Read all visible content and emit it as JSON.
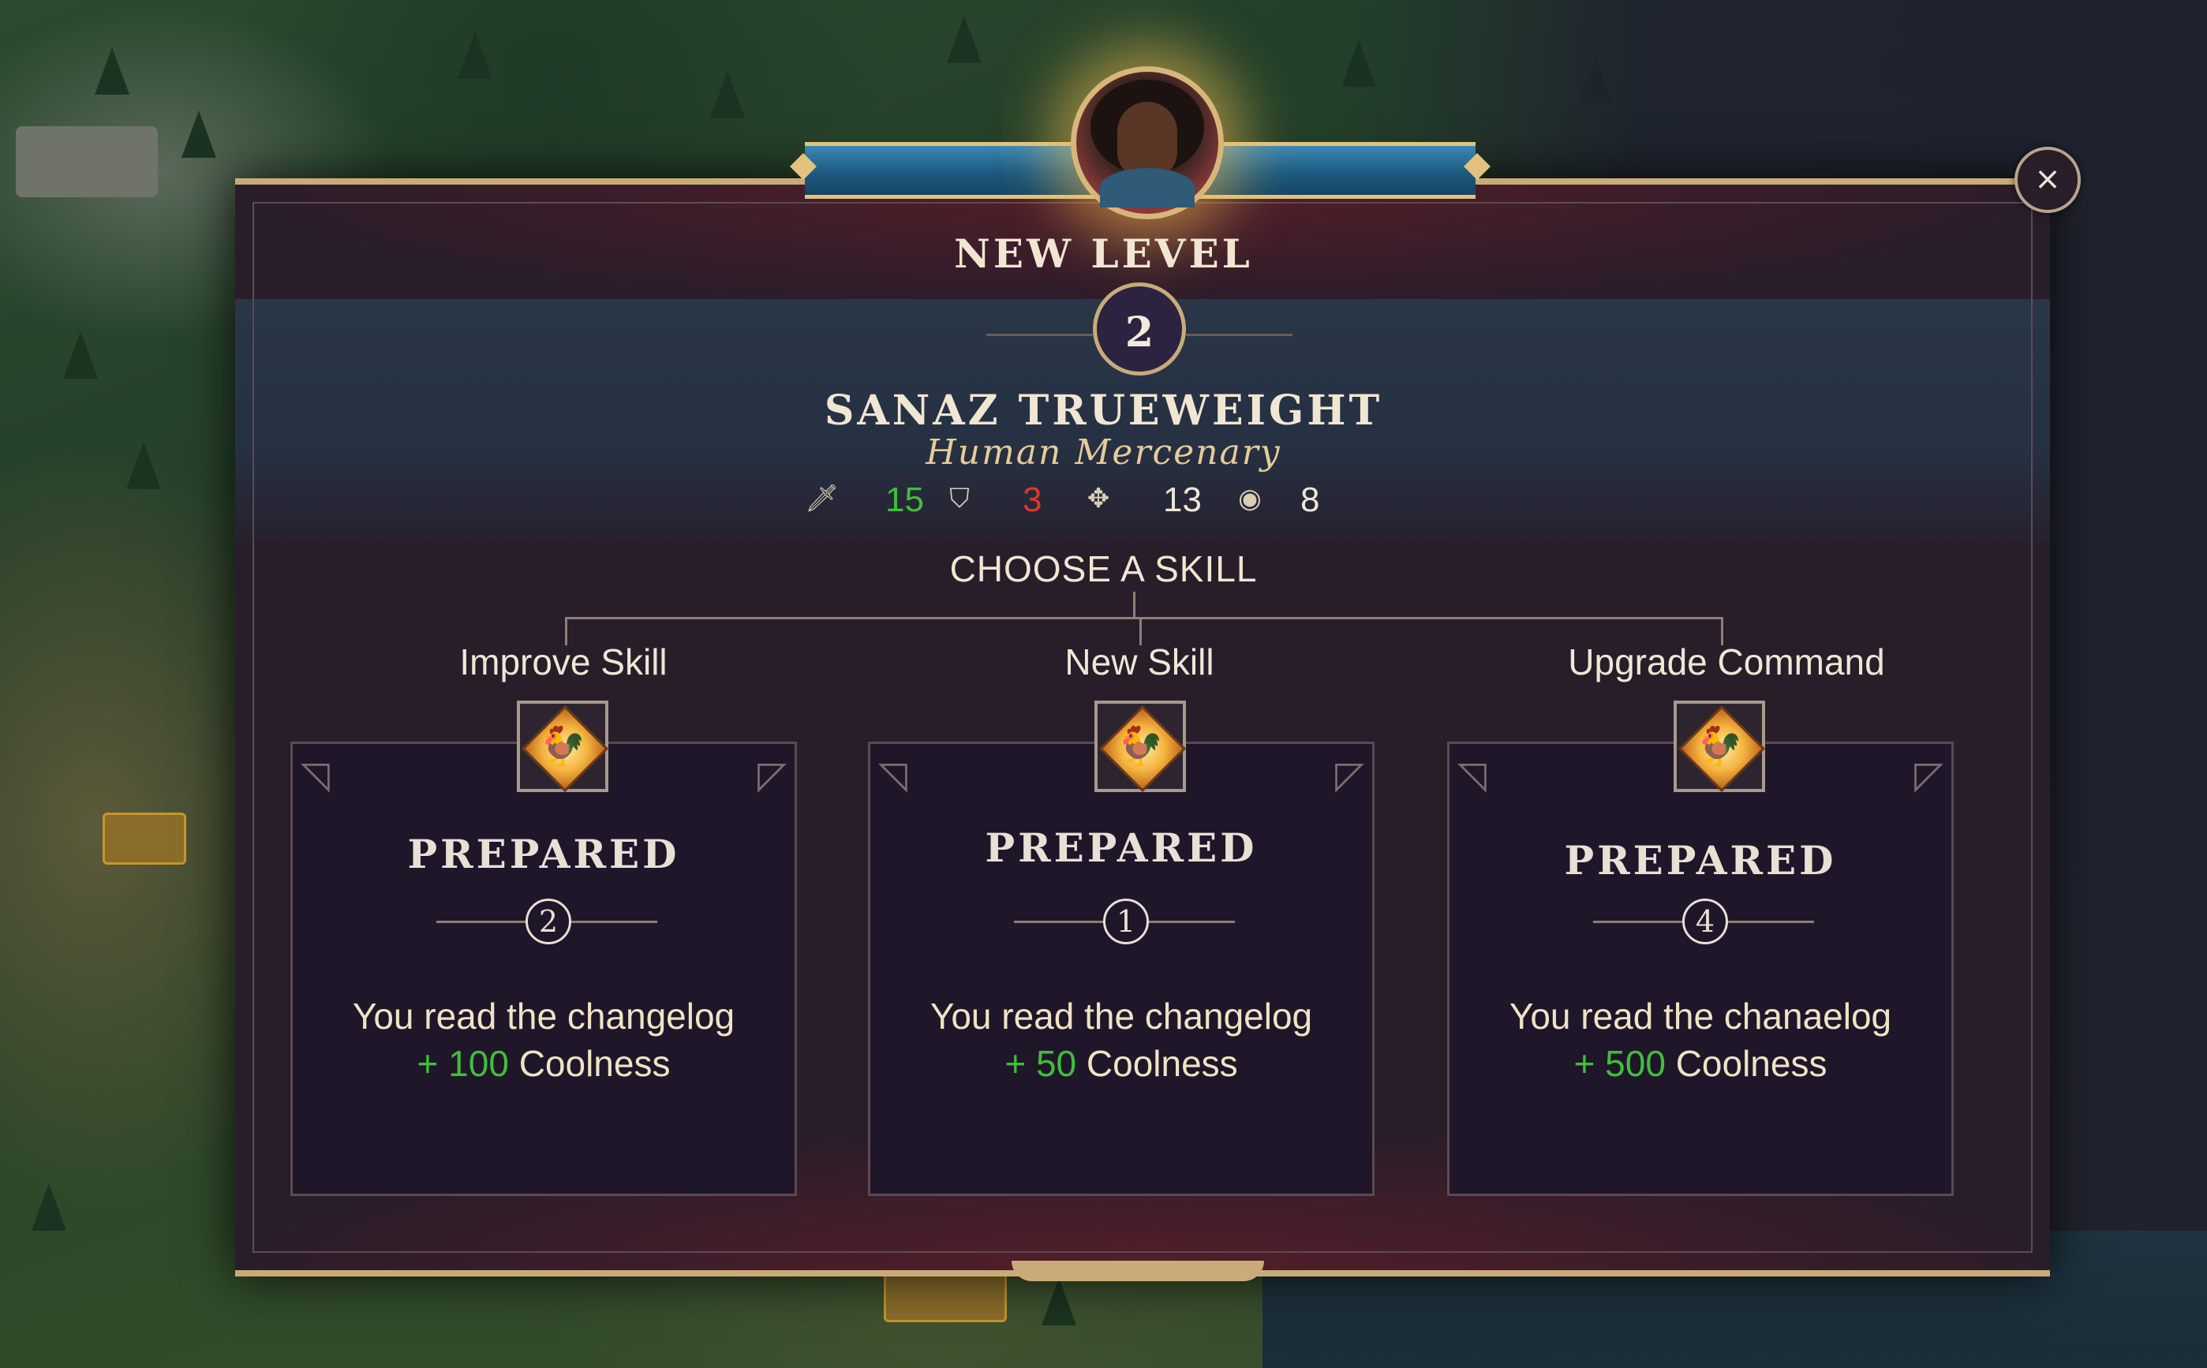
{
  "dialog": {
    "title": "NEW LEVEL",
    "level": "2",
    "close_icon": "×"
  },
  "hero": {
    "name": "SANAZ TRUEWEIGHT",
    "class": "Human Mercenary",
    "stats": [
      {
        "icon": "sword-icon",
        "glyph": "🗡",
        "value": "15",
        "color": "#3fbf3a"
      },
      {
        "icon": "shield-icon",
        "glyph": "⛉",
        "value": "3",
        "color": "#e0362c"
      },
      {
        "icon": "move-icon",
        "glyph": "✥",
        "value": "13",
        "color": "#efe6d6"
      },
      {
        "icon": "eye-icon",
        "glyph": "◉",
        "value": "8",
        "color": "#efe6d6"
      }
    ]
  },
  "choose_label": "CHOOSE A SKILL",
  "options": [
    {
      "label": "Improve Skill",
      "skill_name": "PREPARED",
      "rank": "2",
      "description": "You read the changelog",
      "reward_prefix": "+ 100",
      "reward_suffix": " Coolness"
    },
    {
      "label": "New Skill",
      "skill_name": "PREPARED",
      "rank": "1",
      "description": "You read the changelog",
      "reward_prefix": "+ 50",
      "reward_suffix": " Coolness"
    },
    {
      "label": "Upgrade Command",
      "skill_name": "PREPARED",
      "rank": "4",
      "description": "You read the chanaelog",
      "reward_prefix": "+ 500",
      "reward_suffix": " Coolness"
    }
  ],
  "colors": {
    "positive": "#3fbf3a",
    "negative": "#e0362c",
    "frame_gold": "#c9ab7a",
    "panel": "#2a1d2a"
  }
}
